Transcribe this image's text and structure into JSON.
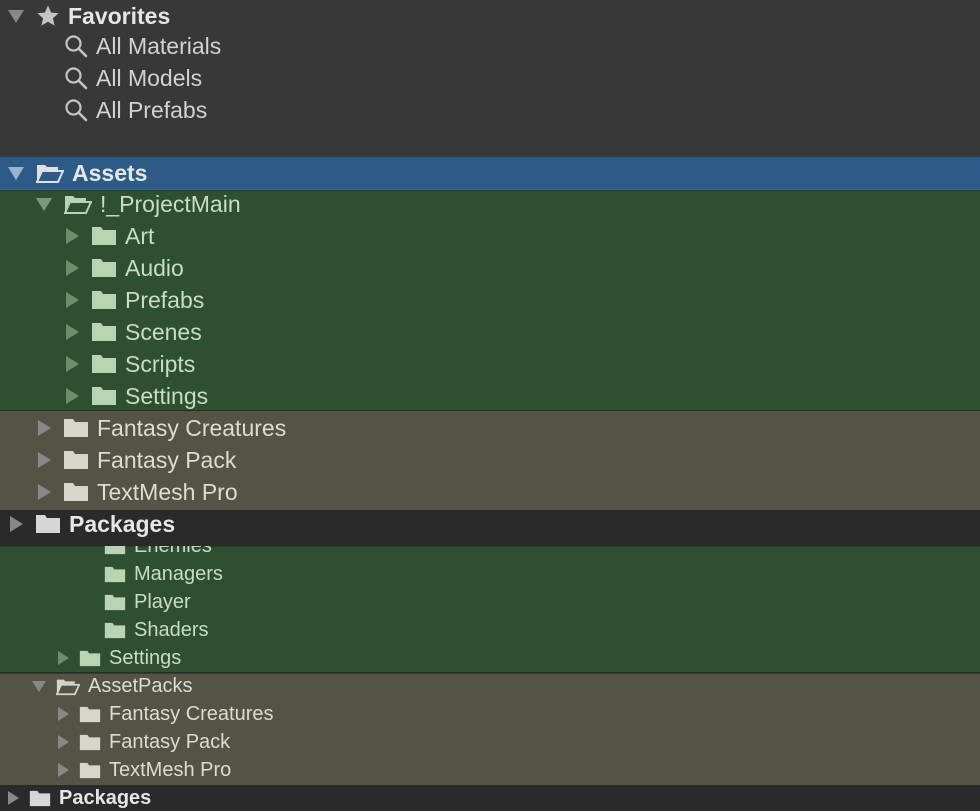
{
  "favorites": {
    "label": "Favorites",
    "items": [
      {
        "label": "All Materials",
        "icon": "search-icon"
      },
      {
        "label": "All Models",
        "icon": "search-icon"
      },
      {
        "label": "All Prefabs",
        "icon": "search-icon"
      }
    ]
  },
  "assets": {
    "label": "Assets",
    "project_main": {
      "label": "!_ProjectMain",
      "children": [
        "Art",
        "Audio",
        "Prefabs",
        "Scenes",
        "Scripts",
        "Settings"
      ]
    },
    "packs": [
      "Fantasy Creatures",
      "Fantasy Pack",
      "TextMesh Pro"
    ]
  },
  "packages": {
    "label": "Packages"
  },
  "lower": {
    "scripts_children": [
      "Enemies",
      "Managers",
      "Player",
      "Shaders"
    ],
    "settings_label": "Settings",
    "asset_packs": {
      "label": "AssetPacks",
      "children": [
        "Fantasy Creatures",
        "Fantasy Pack",
        "TextMesh Pro"
      ]
    },
    "packages_label": "Packages"
  },
  "colors": {
    "selection_blue": "#2c5b87",
    "project_green": "#2f5030",
    "packs_olive": "#545446",
    "panel_bg": "#383838",
    "folder_light": "#d8d6cc",
    "folder_green": "#b8d4b4"
  }
}
